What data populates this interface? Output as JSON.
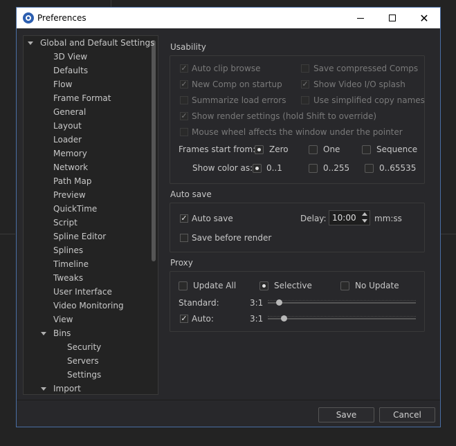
{
  "window": {
    "title": "Preferences"
  },
  "tree": {
    "items": [
      {
        "label": "Global and Default Settings",
        "level": 0,
        "expanded": true
      },
      {
        "label": "3D View",
        "level": 1
      },
      {
        "label": "Defaults",
        "level": 1
      },
      {
        "label": "Flow",
        "level": 1
      },
      {
        "label": "Frame Format",
        "level": 1
      },
      {
        "label": "General",
        "level": 1
      },
      {
        "label": "Layout",
        "level": 1
      },
      {
        "label": "Loader",
        "level": 1
      },
      {
        "label": "Memory",
        "level": 1
      },
      {
        "label": "Network",
        "level": 1
      },
      {
        "label": "Path Map",
        "level": 1
      },
      {
        "label": "Preview",
        "level": 1
      },
      {
        "label": "QuickTime",
        "level": 1
      },
      {
        "label": "Script",
        "level": 1
      },
      {
        "label": "Spline Editor",
        "level": 1
      },
      {
        "label": "Splines",
        "level": 1
      },
      {
        "label": "Timeline",
        "level": 1
      },
      {
        "label": "Tweaks",
        "level": 1
      },
      {
        "label": "User Interface",
        "level": 1
      },
      {
        "label": "Video Monitoring",
        "level": 1
      },
      {
        "label": "View",
        "level": 1
      },
      {
        "label": "Bins",
        "level": 1,
        "expanded": true
      },
      {
        "label": "Security",
        "level": 2
      },
      {
        "label": "Servers",
        "level": 2
      },
      {
        "label": "Settings",
        "level": 2
      },
      {
        "label": "Import",
        "level": 1,
        "expanded": true
      }
    ]
  },
  "usability": {
    "title": "Usability",
    "auto_clip_browse": {
      "label": "Auto clip browse",
      "checked": true,
      "enabled": false
    },
    "save_compressed": {
      "label": "Save compressed Comps",
      "checked": false,
      "enabled": false
    },
    "new_comp": {
      "label": "New Comp on startup",
      "checked": true,
      "enabled": false
    },
    "show_video_io": {
      "label": "Show Video I/O splash",
      "checked": true,
      "enabled": false
    },
    "summarize_errors": {
      "label": "Summarize load errors",
      "checked": false,
      "enabled": false
    },
    "simplified_copy": {
      "label": "Use simplified copy names",
      "checked": false,
      "enabled": false
    },
    "show_render": {
      "label": "Show render settings (hold Shift to override)",
      "checked": true,
      "enabled": false
    },
    "mouse_wheel": {
      "label": "Mouse wheel affects the window under the pointer",
      "checked": false,
      "enabled": false
    },
    "frames_start_label": "Frames start from:",
    "frames_start_options": [
      "Zero",
      "One",
      "Sequence"
    ],
    "frames_start_selected": "Zero",
    "show_color_label": "Show color as:",
    "show_color_options": [
      "0..1",
      "0..255",
      "0..65535"
    ],
    "show_color_selected": "0..1"
  },
  "autosave": {
    "title": "Auto save",
    "auto_save": {
      "label": "Auto save",
      "checked": true
    },
    "delay_label": "Delay:",
    "delay_value": "10:00",
    "delay_unit": "mm:ss",
    "save_before_render": {
      "label": "Save before render",
      "checked": false
    }
  },
  "proxy": {
    "title": "Proxy",
    "modes": [
      "Update All",
      "Selective",
      "No Update"
    ],
    "selected_mode": "Selective",
    "standard_label": "Standard:",
    "standard_value": "3:1",
    "auto_label": "Auto:",
    "auto_value": "3:1",
    "auto_checked": true
  },
  "footer": {
    "save_label": "Save",
    "cancel_label": "Cancel"
  }
}
